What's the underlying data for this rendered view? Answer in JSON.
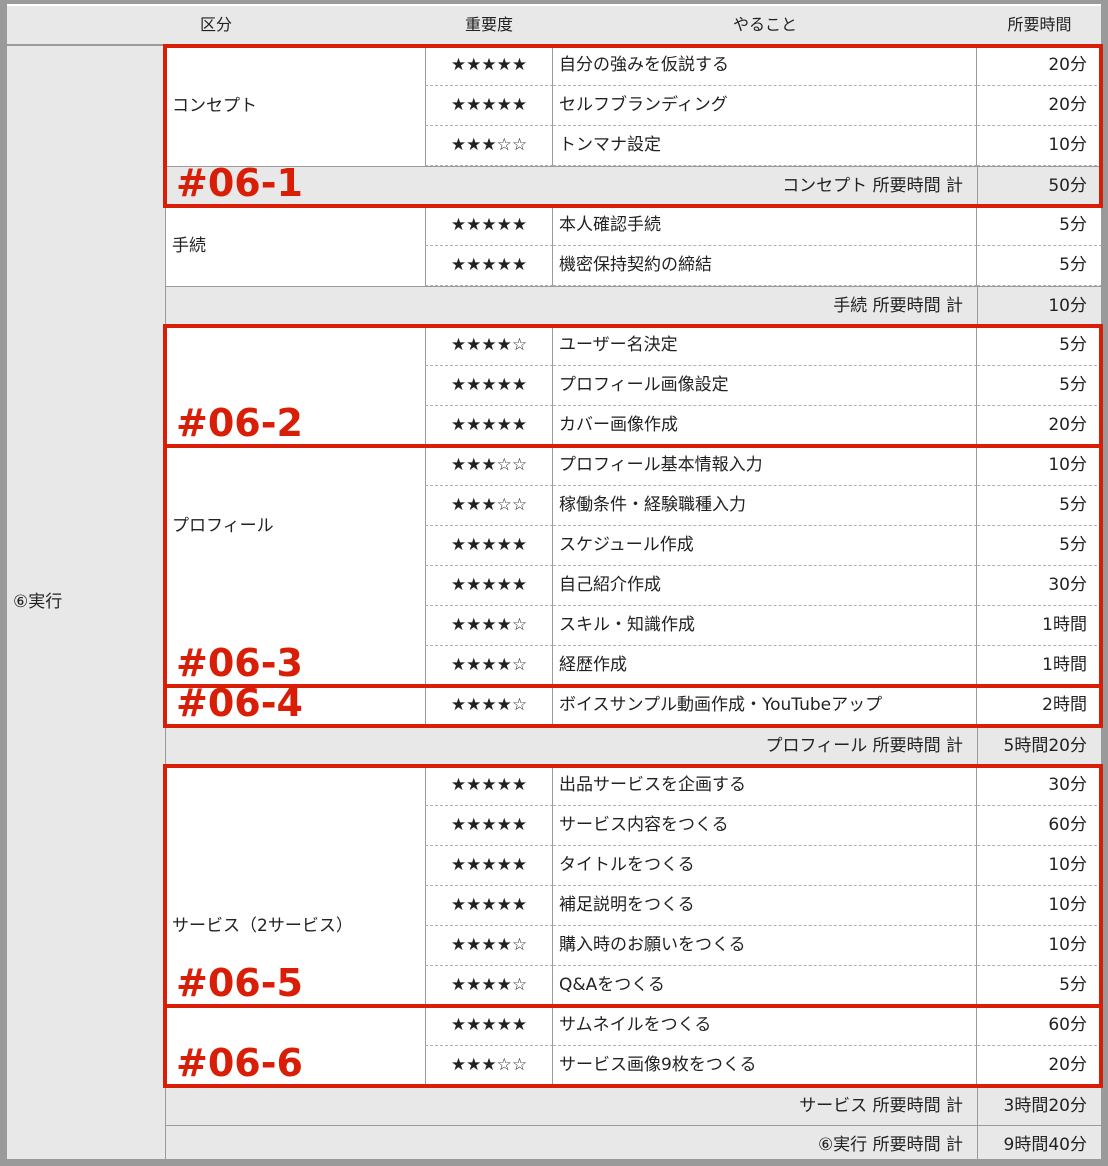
{
  "header": {
    "col_category": "区分",
    "col_importance": "重要度",
    "col_task": "やること",
    "col_time": "所要時間"
  },
  "top_category": "⑥実行",
  "groups": [
    {
      "label": "コンセプト",
      "rows": [
        {
          "stars": "★★★★★",
          "task": "自分の強みを仮説する",
          "time": "20分"
        },
        {
          "stars": "★★★★★",
          "task": "セルフブランディング",
          "time": "20分"
        },
        {
          "stars": "★★★☆☆",
          "task": "トンマナ設定",
          "time": "10分"
        }
      ],
      "total_label": "コンセプト 所要時間 計",
      "total": "50分"
    },
    {
      "label": "手続",
      "rows": [
        {
          "stars": "★★★★★",
          "task": "本人確認手続",
          "time": "5分"
        },
        {
          "stars": "★★★★★",
          "task": "機密保持契約の締結",
          "time": "5分"
        }
      ],
      "total_label": "手続 所要時間 計",
      "total": "10分"
    },
    {
      "label": "プロフィール",
      "rows": [
        {
          "stars": "★★★★☆",
          "task": "ユーザー名決定",
          "time": "5分"
        },
        {
          "stars": "★★★★★",
          "task": "プロフィール画像設定",
          "time": "5分"
        },
        {
          "stars": "★★★★★",
          "task": "カバー画像作成",
          "time": "20分"
        },
        {
          "stars": "★★★☆☆",
          "task": "プロフィール基本情報入力",
          "time": "10分"
        },
        {
          "stars": "★★★☆☆",
          "task": "稼働条件・経験職種入力",
          "time": "5分"
        },
        {
          "stars": "★★★★★",
          "task": "スケジュール作成",
          "time": "5分"
        },
        {
          "stars": "★★★★★",
          "task": "自己紹介作成",
          "time": "30分"
        },
        {
          "stars": "★★★★☆",
          "task": "スキル・知識作成",
          "time": "1時間"
        },
        {
          "stars": "★★★★☆",
          "task": "経歴作成",
          "time": "1時間"
        },
        {
          "stars": "★★★★☆",
          "task": "ボイスサンプル動画作成・YouTubeアップ",
          "time": "2時間"
        }
      ],
      "total_label": "プロフィール 所要時間 計",
      "total": "5時間20分"
    },
    {
      "label": "サービス（2サービス）",
      "rows": [
        {
          "stars": "★★★★★",
          "task": "出品サービスを企画する",
          "time": "30分"
        },
        {
          "stars": "★★★★★",
          "task": "サービス内容をつくる",
          "time": "60分"
        },
        {
          "stars": "★★★★★",
          "task": "タイトルをつくる",
          "time": "10分"
        },
        {
          "stars": "★★★★★",
          "task": "補足説明をつくる",
          "time": "10分"
        },
        {
          "stars": "★★★★☆",
          "task": "購入時のお願いをつくる",
          "time": "10分"
        },
        {
          "stars": "★★★★☆",
          "task": "Q&Aをつくる",
          "time": "5分"
        },
        {
          "stars": "★★★★★",
          "task": "サムネイルをつくる",
          "time": "60分"
        },
        {
          "stars": "★★★☆☆",
          "task": "サービス画像9枚をつくる",
          "time": "20分"
        }
      ],
      "total_label": "サービス 所要時間 計",
      "total": "3時間20分"
    }
  ],
  "grand_total_label": "⑥実行 所要時間 計",
  "grand_total": "9時間40分",
  "tags": [
    "#06-1",
    "#06-2",
    "#06-3",
    "#06-4",
    "#06-5",
    "#06-6"
  ],
  "colors": {
    "annotation_red": "#d81e06",
    "gray_fill": "#e8e8e8",
    "border_gray": "#9a9a9a"
  }
}
